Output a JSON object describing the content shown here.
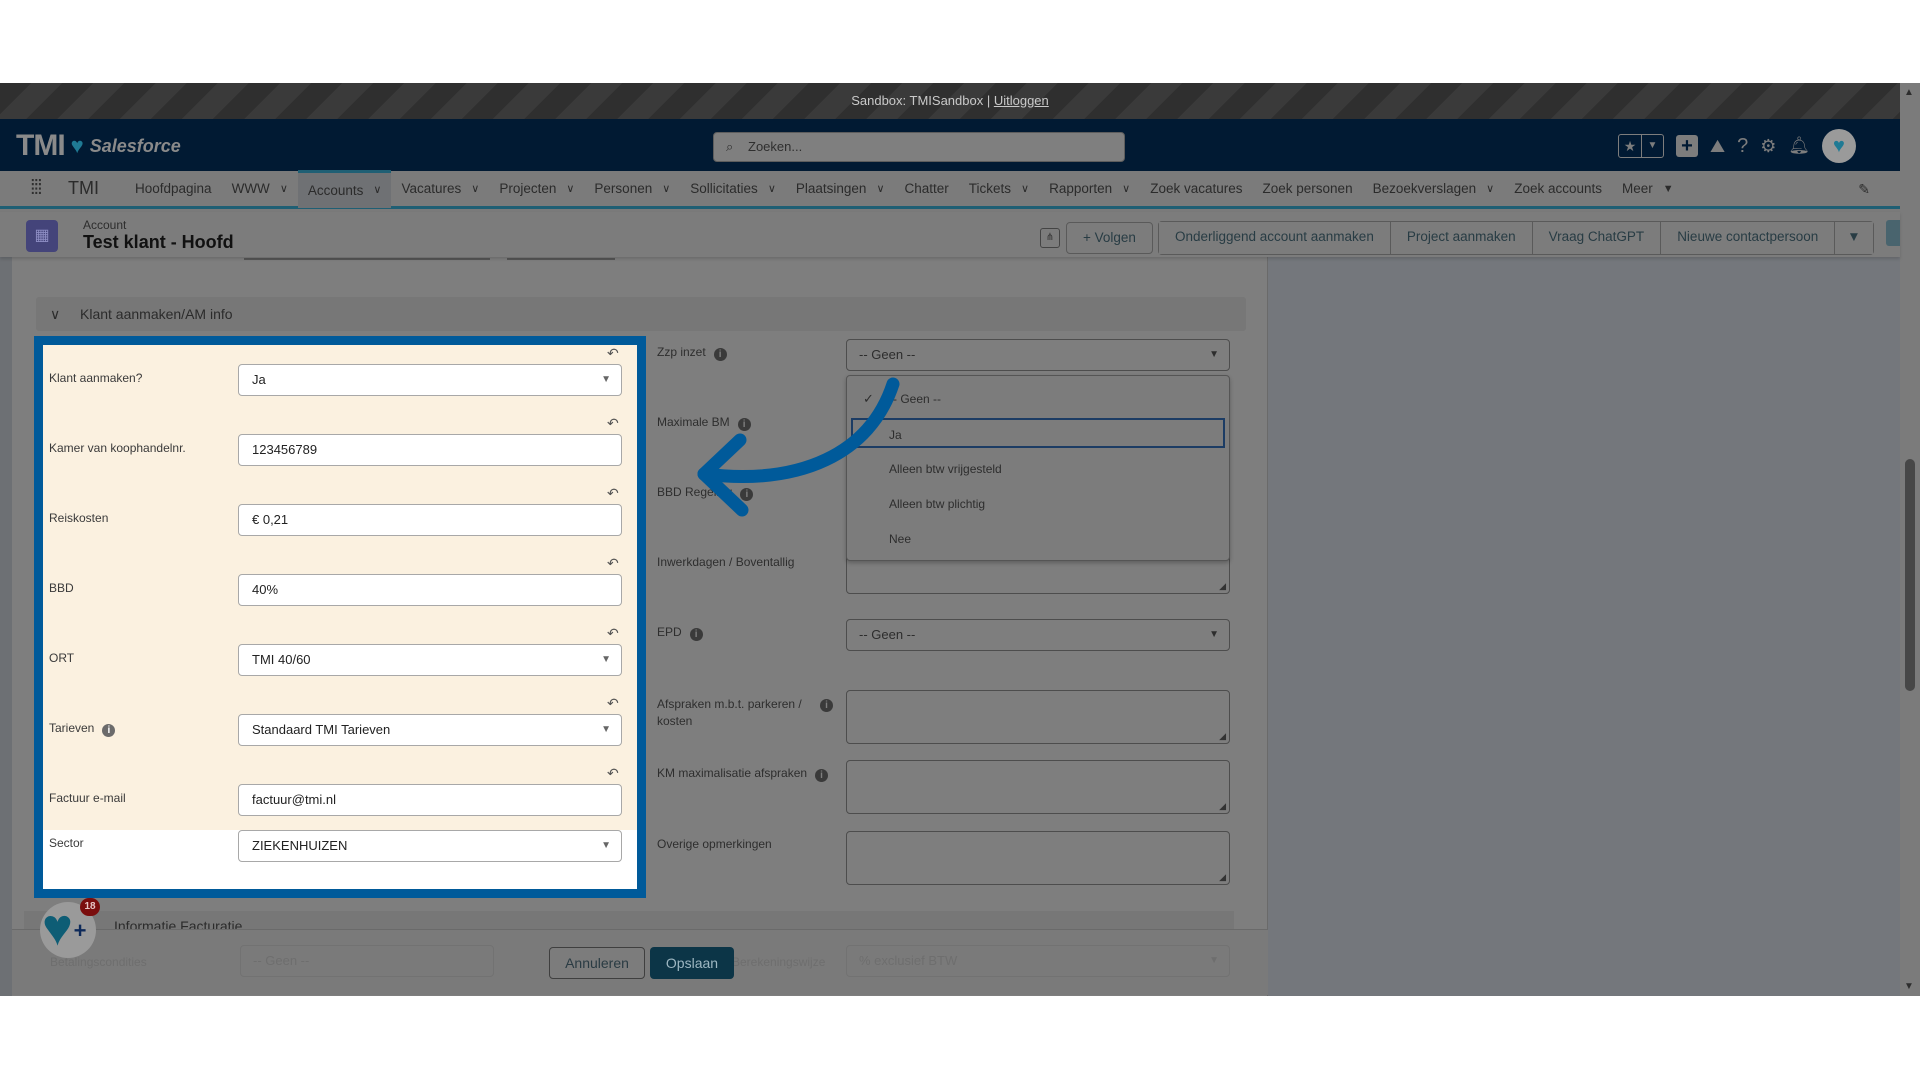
{
  "sandbox": {
    "text": "Sandbox: TMISandbox |",
    "logout": "Uitloggen"
  },
  "header": {
    "logo_text": "TMI",
    "logo_heart": "heart-plus-icon",
    "logo_sub": "Salesforce",
    "search_placeholder": "Zoeken...",
    "icons": [
      "star-icon",
      "chevron-down-icon",
      "add-icon",
      "trailhead-icon",
      "help-icon",
      "gear-icon",
      "bell-icon",
      "avatar-icon"
    ]
  },
  "nav": {
    "app_name": "TMI",
    "items": [
      {
        "label": "Hoofdpagina",
        "dropdown": false
      },
      {
        "label": "WWW",
        "dropdown": true
      },
      {
        "label": "Accounts",
        "dropdown": true,
        "active": true
      },
      {
        "label": "Vacatures",
        "dropdown": true
      },
      {
        "label": "Projecten",
        "dropdown": true
      },
      {
        "label": "Personen",
        "dropdown": true
      },
      {
        "label": "Sollicitaties",
        "dropdown": true
      },
      {
        "label": "Plaatsingen",
        "dropdown": true
      },
      {
        "label": "Chatter",
        "dropdown": false
      },
      {
        "label": "Tickets",
        "dropdown": true
      },
      {
        "label": "Rapporten",
        "dropdown": true
      },
      {
        "label": "Zoek vacatures",
        "dropdown": false
      },
      {
        "label": "Zoek personen",
        "dropdown": false
      },
      {
        "label": "Bezoekverslagen",
        "dropdown": true
      },
      {
        "label": "Zoek accounts",
        "dropdown": false
      },
      {
        "label": "Meer",
        "dropdown": true
      }
    ]
  },
  "record": {
    "type": "Account",
    "title": "Test klant - Hoofd",
    "actions": {
      "follow": "Volgen",
      "group": [
        "Onderliggend account aanmaken",
        "Project aanmaken",
        "Vraag ChatGPT",
        "Nieuwe contactpersoon"
      ]
    }
  },
  "section": {
    "title": "Klant aanmaken/AM info"
  },
  "highlighted_fields": [
    {
      "label": "Klant aanmaken?",
      "value": "Ja",
      "type": "select",
      "info": false
    },
    {
      "label": "Kamer van koophandelnr.",
      "value": "123456789",
      "type": "text",
      "info": false
    },
    {
      "label": "Reiskosten",
      "value": "€ 0,21",
      "type": "text",
      "info": false
    },
    {
      "label": "BBD",
      "value": "40%",
      "type": "text",
      "info": false
    },
    {
      "label": "ORT",
      "value": "TMI 40/60",
      "type": "select",
      "info": false
    },
    {
      "label": "Tarieven",
      "value": "Standaard TMI Tarieven",
      "type": "select",
      "info": true
    },
    {
      "label": "Factuur e-mail",
      "value": "factuur@tmi.nl",
      "type": "text",
      "info": false
    },
    {
      "label": "Sector",
      "value": "ZIEKENHUIZEN",
      "type": "select",
      "info": false
    }
  ],
  "right_fields": {
    "zzp": {
      "label": "Zzp inzet",
      "value": "-- Geen --"
    },
    "max_bm": {
      "label": "Maximale BM"
    },
    "bbd_regeling": {
      "label": "BBD Regeling"
    },
    "inwerkdagen": {
      "label": "Inwerkdagen / Boventallig"
    },
    "epd": {
      "label": "EPD",
      "value": "-- Geen --"
    },
    "parkeren": {
      "label": "Afspraken m.b.t. parkeren / kosten"
    },
    "km": {
      "label": "KM maximalisatie afspraken"
    },
    "overige": {
      "label": "Overige opmerkingen"
    }
  },
  "dropdown": {
    "options": [
      "-- Geen --",
      "Ja",
      "Alleen btw vrijgesteld",
      "Alleen btw plichtig",
      "Nee"
    ],
    "selected": "-- Geen --",
    "focused": "Ja"
  },
  "footer": {
    "section_title": "Informatie Facturatie",
    "ghost_label_left": "Betalingscondities",
    "ghost_value_left": "-- Geen --",
    "ghost_label_right": "Berekeningswijze",
    "ghost_value_right": "% exclusief BTW",
    "cancel": "Annuleren",
    "save": "Opslaan"
  },
  "chat": {
    "badge": "18"
  },
  "colors": {
    "highlight": "#005a9a",
    "save": "#0c3547",
    "banner": "#011a33"
  }
}
